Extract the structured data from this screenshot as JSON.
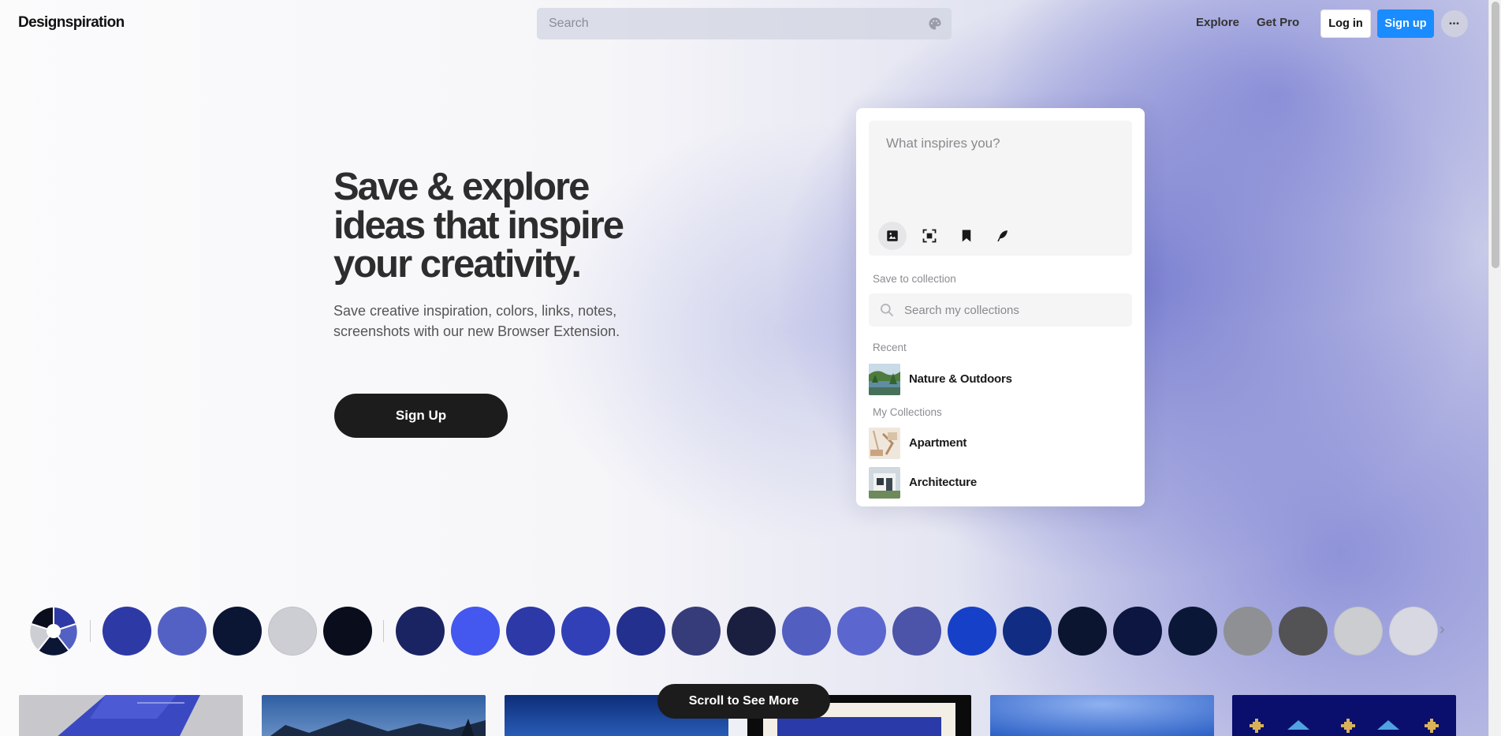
{
  "header": {
    "logo": "Designspiration",
    "search_placeholder": "Search",
    "nav": {
      "explore": "Explore",
      "get_pro": "Get Pro"
    },
    "login_label": "Log in",
    "signup_label": "Sign up",
    "more_label": "•••"
  },
  "hero": {
    "title": "Save & explore ideas that inspire your creativity.",
    "subtitle": "Save creative inspiration, colors, links, notes, screenshots with our new Browser Extension.",
    "cta_label": "Sign Up"
  },
  "extension_card": {
    "compose_placeholder": "What inspires you?",
    "tools": [
      "image-icon",
      "screenshot-icon",
      "bookmark-icon",
      "feather-icon"
    ],
    "save_to_collection_label": "Save to collection",
    "search_collections_placeholder": "Search my collections",
    "recent_label": "Recent",
    "recent": [
      {
        "name": "Nature & Outdoors"
      }
    ],
    "my_collections_label": "My Collections",
    "my_collections": [
      {
        "name": "Apartment"
      },
      {
        "name": "Architecture"
      }
    ]
  },
  "color_strip": {
    "primary_swatches": [
      "#2d3aa6",
      "#5461c4",
      "#0b1534",
      "#cdced3",
      "#0a0e1c"
    ],
    "swatches": [
      "#1b2463",
      "#4457ee",
      "#2c39a7",
      "#3240b8",
      "#24308d",
      "#363c7a",
      "#1a1f40",
      "#525ec0",
      "#5c66cf",
      "#4b54a8",
      "#1640c8",
      "#112d83",
      "#0b1530",
      "#0c1640",
      "#0b1737",
      "#8f9093",
      "#535356",
      "#cccdd0",
      "#d7d8e2"
    ]
  },
  "scroll_pill_label": "Scroll to See More",
  "thumbnails": [
    "blue-cards",
    "sky-trees",
    "night-sky",
    "framed-print",
    "blue-gradient",
    "pixel-pattern"
  ]
}
